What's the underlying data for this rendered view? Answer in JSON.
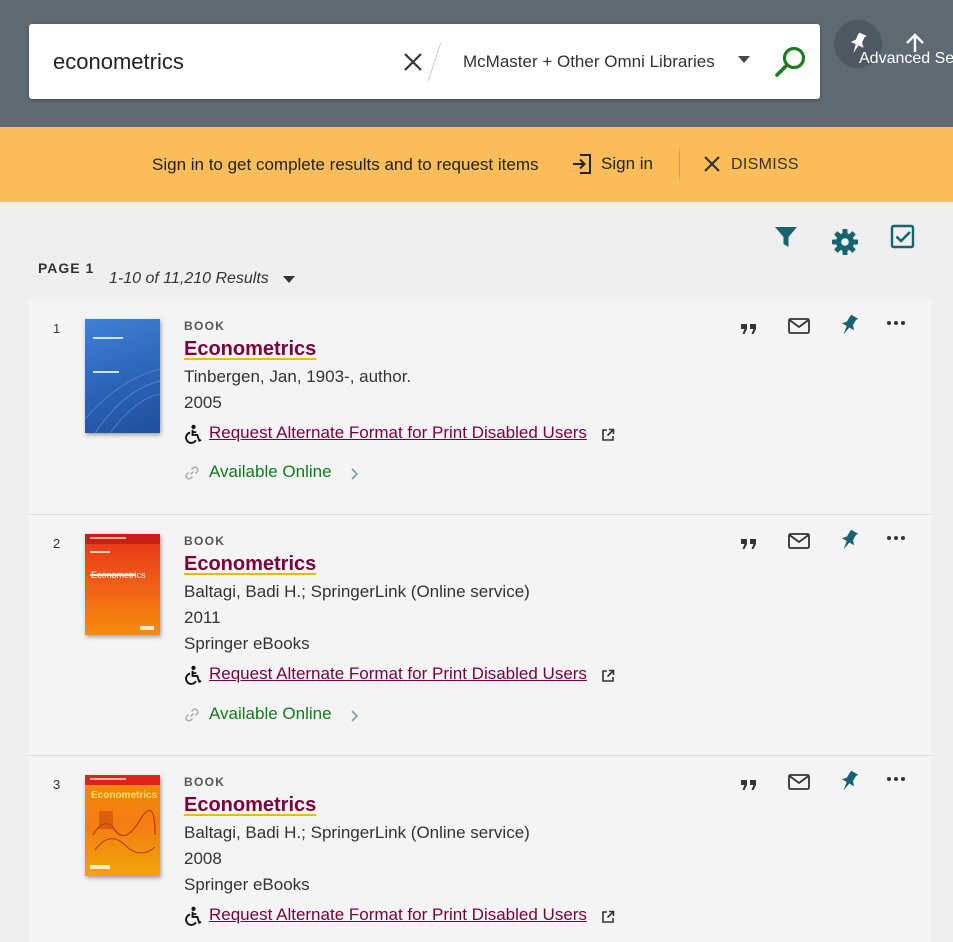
{
  "search": {
    "query": "econometrics",
    "scope": "McMaster + Other Omni Libraries"
  },
  "header": {
    "advanced_search_label": "Advanced Se"
  },
  "banner": {
    "message": "Sign in to get complete results and to request items",
    "signin_label": "Sign in",
    "dismiss_label": "DISMISS"
  },
  "toolbar": {
    "page_label": "PAGE 1",
    "result_count": "1-10 of 11,210 Results"
  },
  "results": [
    {
      "number": "1",
      "type": "BOOK",
      "title": "Econometrics",
      "author": "Tinbergen, Jan, 1903-, author.",
      "year": "2005",
      "collection": "",
      "request_link": "Request Alternate Format for Print Disabled Users",
      "availability": "Available Online",
      "cover_color": "#2f6cc0"
    },
    {
      "number": "2",
      "type": "BOOK",
      "title": "Econometrics",
      "author": "Baltagi, Badi H.; SpringerLink (Online service)",
      "year": "2011",
      "collection": "Springer eBooks",
      "request_link": "Request Alternate Format for Print Disabled Users",
      "availability": "Available Online",
      "cover_color": "#e9501e"
    },
    {
      "number": "3",
      "type": "BOOK",
      "title": "Econometrics",
      "author": "Baltagi, Badi H.; SpringerLink (Online service)",
      "year": "2008",
      "collection": "Springer eBooks",
      "request_link": "Request Alternate Format for Print Disabled Users",
      "availability": "",
      "cover_color": "#f57d12"
    }
  ],
  "colors": {
    "header_bg": "#5f6971",
    "banner_bg": "#fbbd59",
    "title_link": "#7a003c",
    "available": "#117a1b",
    "icon_teal": "#176372"
  }
}
